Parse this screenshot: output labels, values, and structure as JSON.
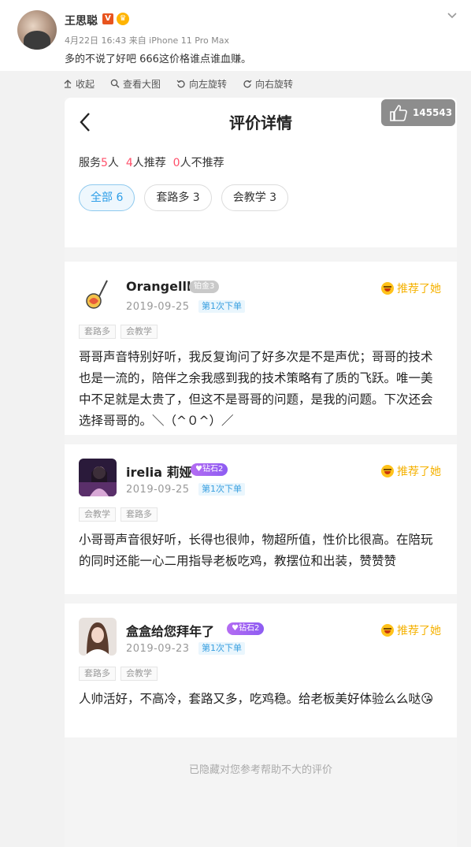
{
  "post": {
    "author": "王思聪",
    "vip_badge": "V",
    "crown_icon": "crown-icon",
    "meta": "4月22日 16:43 来自 iPhone 11 Pro Max",
    "text": "多的不说了好吧 666这价格谁点谁血赚。"
  },
  "viewer": {
    "tools": [
      {
        "icon": "collapse-icon",
        "label": "收起"
      },
      {
        "icon": "search-icon",
        "label": "查看大图"
      },
      {
        "icon": "rotate-left-icon",
        "label": "向左旋转"
      },
      {
        "icon": "rotate-right-icon",
        "label": "向右旋转"
      }
    ],
    "like_count": "145543"
  },
  "app": {
    "title": "评价详情",
    "summary": {
      "service_label": "服务",
      "service_count": "5",
      "service_unit": "人",
      "recommend_count": "4",
      "recommend_label": "人推荐",
      "not_recommend_count": "0",
      "not_recommend_label": "人不推荐"
    },
    "filters": [
      {
        "label": "全部 6",
        "active": true
      },
      {
        "label": "套路多 3",
        "active": false
      },
      {
        "label": "会教学 3",
        "active": false
      }
    ],
    "reviews": [
      {
        "user": "Orangelll",
        "rank": "铂金3",
        "date": "2019-09-25",
        "order": "第1次下单",
        "recommend": "推荐了她",
        "tags": [
          "套路多",
          "会教学"
        ],
        "text": "哥哥声音特别好听，我反复询问了好多次是不是声优；哥哥的技术也是一流的，陪伴之余我感到我的技术策略有了质的飞跃。唯一美中不足就是太贵了，但这不是哥哥的问题，是我的问题。下次还会选择哥哥的。＼（^０^）／"
      },
      {
        "user": "irelia 莉娅",
        "rank": "♥钻石2",
        "date": "2019-09-25",
        "order": "第1次下单",
        "recommend": "推荐了她",
        "tags": [
          "会教学",
          "套路多"
        ],
        "text": "小哥哥声音很好听，长得也很帅，物超所值，性价比很高。在陪玩的同时还能一心二用指导老板吃鸡，教摆位和出装，赞赞赞"
      },
      {
        "user": "盒盒给您拜年了",
        "rank": "♥钻石2",
        "date": "2019-09-23",
        "order": "第1次下单",
        "recommend": "推荐了她",
        "tags": [
          "套路多",
          "会教学"
        ],
        "text": "人帅活好，不高冷，套路又多，吃鸡稳。给老板美好体验么么哒😘"
      }
    ],
    "footer": "已隐藏对您参考帮助不大的评价"
  },
  "colors": {
    "accent_blue": "#2d9ee8",
    "count_red": "#ff4f6a",
    "recommend_yellow": "#f5b100",
    "rank_purple": "#a064f2"
  }
}
